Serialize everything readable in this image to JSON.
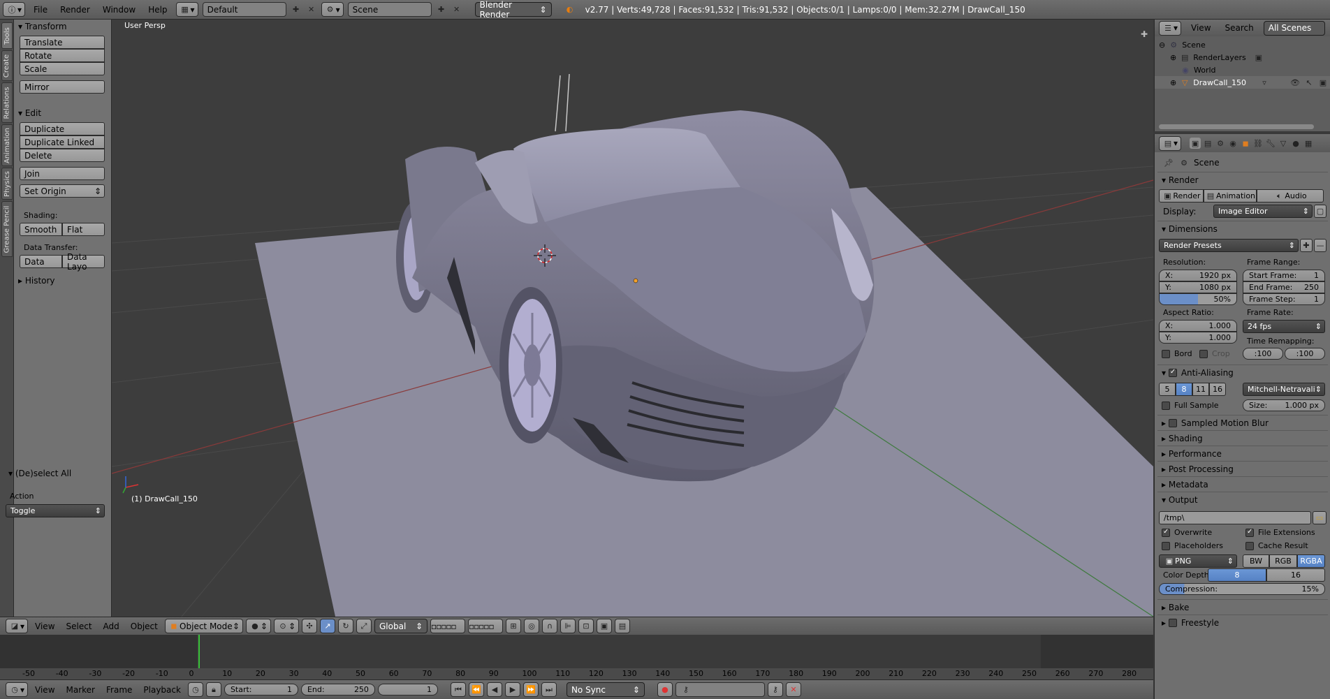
{
  "topbar": {
    "menus": [
      "File",
      "Render",
      "Window",
      "Help"
    ],
    "layout": "Default",
    "scene": "Scene",
    "engine": "Blender Render",
    "info": "v2.77 | Verts:49,728 | Faces:91,532 | Tris:91,532 | Objects:0/1 | Lamps:0/0 | Mem:32.27M | DrawCall_150"
  },
  "tabs": [
    "Tools",
    "Create",
    "Relations",
    "Animation",
    "Physics",
    "Grease Pencil"
  ],
  "shelf": {
    "transform_header": "Transform",
    "translate": "Translate",
    "rotate": "Rotate",
    "scale": "Scale",
    "mirror": "Mirror",
    "edit_header": "Edit",
    "duplicate": "Duplicate",
    "duplicate_linked": "Duplicate Linked",
    "delete": "Delete",
    "join": "Join",
    "set_origin": "Set Origin",
    "shading_label": "Shading:",
    "smooth": "Smooth",
    "flat": "Flat",
    "data_transfer_label": "Data Transfer:",
    "data": "Data",
    "data_layo": "Data Layo",
    "history_header": "History",
    "deselect_header": "(De)select All",
    "action_label": "Action",
    "action_value": "Toggle"
  },
  "viewport": {
    "view_name": "User Persp",
    "object_label": "(1) DrawCall_150"
  },
  "vp_header": {
    "view": "View",
    "select": "Select",
    "add": "Add",
    "object": "Object",
    "mode": "Object Mode",
    "orientation": "Global"
  },
  "timeline": {
    "ticks": [
      "-50",
      "-40",
      "-30",
      "-20",
      "-10",
      "0",
      "10",
      "20",
      "30",
      "40",
      "50",
      "60",
      "70",
      "80",
      "90",
      "100",
      "110",
      "120",
      "130",
      "140",
      "150",
      "160",
      "170",
      "180",
      "190",
      "200",
      "210",
      "220",
      "230",
      "240",
      "250",
      "260",
      "270",
      "280"
    ],
    "view": "View",
    "marker": "Marker",
    "frame": "Frame",
    "playback": "Playback",
    "start_label": "Start:",
    "start": "1",
    "end_label": "End:",
    "end": "250",
    "current": "1",
    "sync": "No Sync"
  },
  "outliner": {
    "view": "View",
    "search": "Search",
    "filter": "All Scenes",
    "items": [
      "Scene",
      "RenderLayers",
      "World",
      "DrawCall_150"
    ]
  },
  "props": {
    "context": "Scene",
    "render_header": "Render",
    "render_btn": "Render",
    "animation_btn": "Animation",
    "audio_btn": "Audio",
    "display_label": "Display:",
    "display_value": "Image Editor",
    "dimensions_header": "Dimensions",
    "presets": "Render Presets",
    "resolution_label": "Resolution:",
    "res_x_label": "X:",
    "res_x": "1920 px",
    "res_y_label": "Y:",
    "res_y": "1080 px",
    "res_pct": "50%",
    "frame_range_label": "Frame Range:",
    "start_frame_label": "Start Frame:",
    "start_frame": "1",
    "end_frame_label": "End Frame:",
    "end_frame": "250",
    "frame_step_label": "Frame Step:",
    "frame_step": "1",
    "aspect_label": "Aspect Ratio:",
    "asp_x_label": "X:",
    "asp_x": "1.000",
    "asp_y_label": "Y:",
    "asp_y": "1.000",
    "frame_rate_label": "Frame Rate:",
    "frame_rate": "24 fps",
    "time_remap_label": "Time Remapping:",
    "remap_old": ":100",
    "remap_new": ":100",
    "bord": "Bord",
    "crop": "Crop",
    "aa_header": "Anti-Aliasing",
    "aa_samples": [
      "5",
      "8",
      "11",
      "16"
    ],
    "aa_filter": "Mitchell-Netravali",
    "full_sample": "Full Sample",
    "aa_size_label": "Size:",
    "aa_size": "1.000 px",
    "sampled_motion_blur": "Sampled Motion Blur",
    "shading": "Shading",
    "performance": "Performance",
    "post_processing": "Post Processing",
    "metadata": "Metadata",
    "output_header": "Output",
    "output_path": "/tmp\\",
    "overwrite": "Overwrite",
    "file_extensions": "File Extensions",
    "placeholders": "Placeholders",
    "cache_result": "Cache Result",
    "format": "PNG",
    "bw": "BW",
    "rgb": "RGB",
    "rgba": "RGBA",
    "color_depth_label": "Color Depth:",
    "depth_8": "8",
    "depth_16": "16",
    "compression_label": "Compression:",
    "compression": "15%",
    "bake": "Bake",
    "freestyle": "Freestyle"
  }
}
